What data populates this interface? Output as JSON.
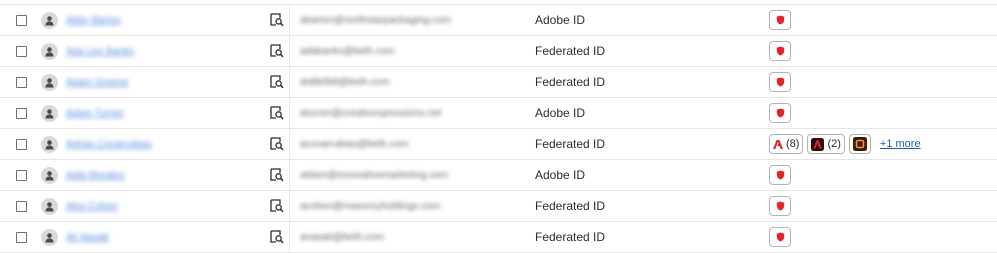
{
  "users": [
    {
      "name": "Abby Barton",
      "email": "abarton@northstarpackaging.com",
      "id_type": "Adobe ID",
      "products": "single"
    },
    {
      "name": "Ada Lee Banks",
      "email": "adabanks@beth.com",
      "id_type": "Federated ID",
      "products": "single"
    },
    {
      "name": "Adam Greene",
      "email": "ds8b0b9@beth.com",
      "id_type": "Federated ID",
      "products": "single"
    },
    {
      "name": "Adam Turner",
      "email": "aturner@creativexpressions.net",
      "id_type": "Adobe ID",
      "products": "single"
    },
    {
      "name": "Adrian Covarrubias",
      "email": "acovarrubias@beth.com",
      "id_type": "Federated ID",
      "products": "multi"
    },
    {
      "name": "Aida Morales",
      "email": "aidam@innovativemarketing.com",
      "id_type": "Adobe ID",
      "products": "single"
    },
    {
      "name": "Alex Cohen",
      "email": "acohen@masonryholdings.com",
      "id_type": "Federated ID",
      "products": "single"
    },
    {
      "name": "Ali Nasab",
      "email": "anasab@beth.com",
      "id_type": "Federated ID",
      "products": "single"
    }
  ],
  "product_chips": {
    "acrobat_count": "(8)",
    "creative_cloud_count": "(2)",
    "more_label": "+1 more"
  },
  "icons": {
    "checkbox": "checkbox-icon",
    "avatar": "user-avatar-icon",
    "inspect": "inspect-user-icon",
    "shield": "shield-product-icon",
    "acrobat": "acrobat-icon",
    "creative_cloud": "creative-cloud-icon",
    "app": "app-icon"
  },
  "colors": {
    "link": "#1a5fb4",
    "shield_red": "#e0262c",
    "acrobat_red": "#e0262c",
    "cc_bg": "#2b0a0a",
    "app_bg": "#3d1a0a",
    "app_accent": "#f29b1d"
  }
}
